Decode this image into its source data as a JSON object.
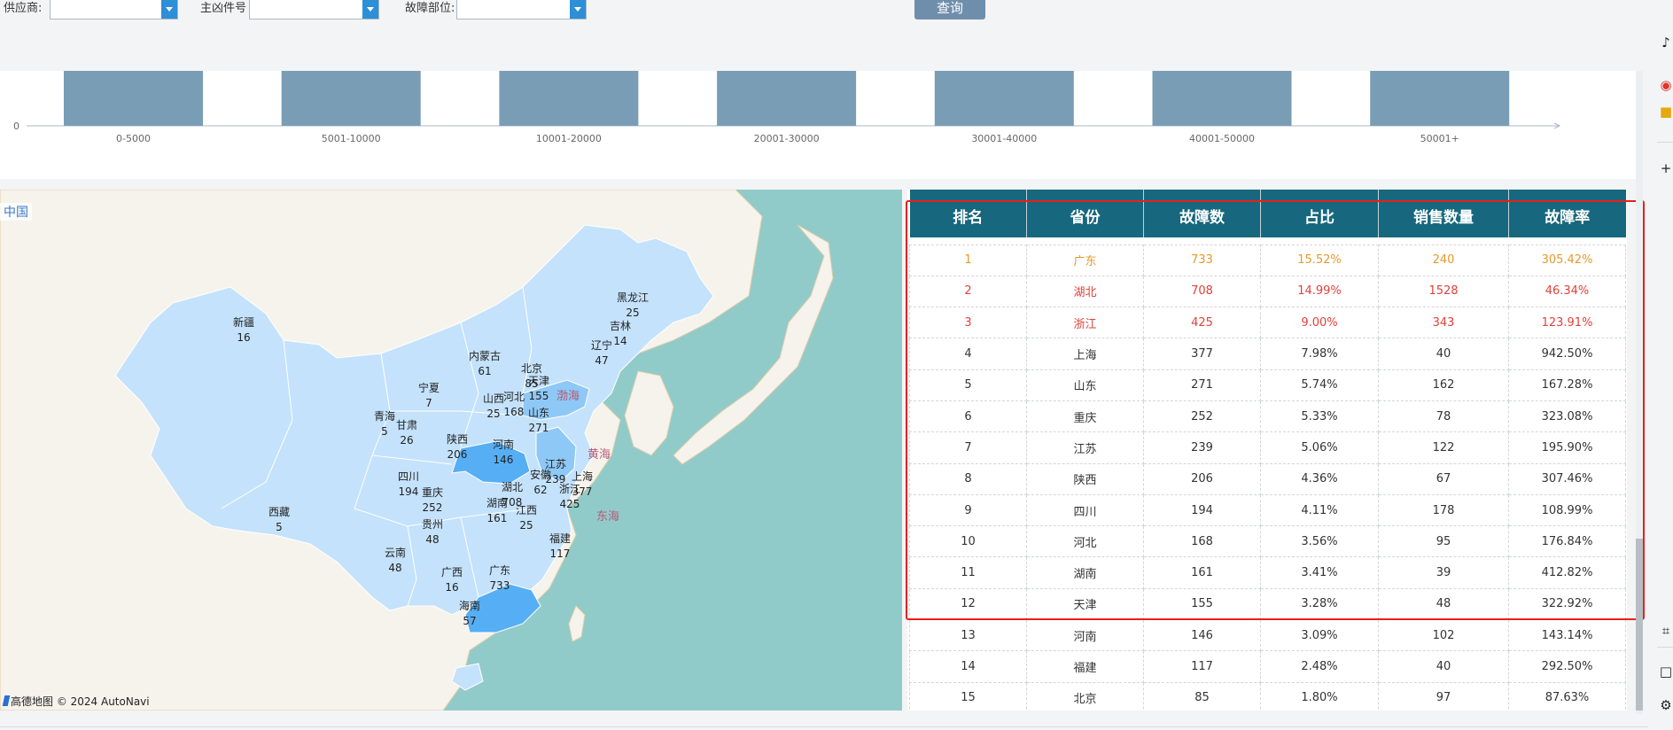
{
  "filters": {
    "supplier_label": "供应商:",
    "supplier_value": "",
    "part_label": "主凶件号",
    "part_value": "",
    "position_label": "故障部位:",
    "position_value": "",
    "query_label": "查询"
  },
  "chart_data": {
    "type": "bar",
    "categories": [
      "0-5000",
      "5001-10000",
      "10001-20000",
      "20001-30000",
      "30001-40000",
      "40001-50000",
      "50001+"
    ],
    "y_tick_visible": "0",
    "color": "#7a9db6",
    "grid": false
  },
  "map": {
    "country_label": "中国",
    "attribution": "高德地图 © 2024 AutoNavi",
    "land_color": "#f6f3ed",
    "sea_color": "#91cbc9",
    "highlight_colors": [
      "#c4e2fb",
      "#8ec8f6",
      "#56aef5"
    ],
    "sea_labels": [
      {
        "name": "渤海"
      },
      {
        "name": "黄海"
      },
      {
        "name": "东海"
      }
    ],
    "provinces": [
      {
        "name": "黑龙江",
        "value": "25"
      },
      {
        "name": "吉林",
        "value": "14"
      },
      {
        "name": "辽宁",
        "value": "47"
      },
      {
        "name": "新疆",
        "value": "16"
      },
      {
        "name": "内蒙古",
        "value": "61"
      },
      {
        "name": "北京",
        "value": "85"
      },
      {
        "name": "天津",
        "value": "155"
      },
      {
        "name": "河北",
        "value": "168"
      },
      {
        "name": "山西",
        "value": "25"
      },
      {
        "name": "宁夏",
        "value": "7"
      },
      {
        "name": "山东",
        "value": "271"
      },
      {
        "name": "青海",
        "value": "5"
      },
      {
        "name": "甘肃",
        "value": "26"
      },
      {
        "name": "陕西",
        "value": "206"
      },
      {
        "name": "河南",
        "value": "146"
      },
      {
        "name": "江苏",
        "value": "239"
      },
      {
        "name": "安徽",
        "value": "62"
      },
      {
        "name": "上海",
        "value": "377"
      },
      {
        "name": "四川",
        "value": "194"
      },
      {
        "name": "湖北",
        "value": "708"
      },
      {
        "name": "浙江",
        "value": "425"
      },
      {
        "name": "重庆",
        "value": "252"
      },
      {
        "name": "西藏",
        "value": "5"
      },
      {
        "name": "湖南",
        "value": "161"
      },
      {
        "name": "江西",
        "value": "25"
      },
      {
        "name": "贵州",
        "value": "48"
      },
      {
        "name": "福建",
        "value": "117"
      },
      {
        "name": "云南",
        "value": "48"
      },
      {
        "name": "广西",
        "value": "16"
      },
      {
        "name": "广东",
        "value": "733"
      },
      {
        "name": "海南",
        "value": "57"
      }
    ]
  },
  "table": {
    "headers": [
      "排名",
      "省份",
      "故障数",
      "占比",
      "销售数量",
      "故障率"
    ],
    "rows": [
      [
        "1",
        "广东",
        "733",
        "15.52%",
        "240",
        "305.42%"
      ],
      [
        "2",
        "湖北",
        "708",
        "14.99%",
        "1528",
        "46.34%"
      ],
      [
        "3",
        "浙江",
        "425",
        "9.00%",
        "343",
        "123.91%"
      ],
      [
        "4",
        "上海",
        "377",
        "7.98%",
        "40",
        "942.50%"
      ],
      [
        "5",
        "山东",
        "271",
        "5.74%",
        "162",
        "167.28%"
      ],
      [
        "6",
        "重庆",
        "252",
        "5.33%",
        "78",
        "323.08%"
      ],
      [
        "7",
        "江苏",
        "239",
        "5.06%",
        "122",
        "195.90%"
      ],
      [
        "8",
        "陕西",
        "206",
        "4.36%",
        "67",
        "307.46%"
      ],
      [
        "9",
        "四川",
        "194",
        "4.11%",
        "178",
        "108.99%"
      ],
      [
        "10",
        "河北",
        "168",
        "3.56%",
        "95",
        "176.84%"
      ],
      [
        "11",
        "湖南",
        "161",
        "3.41%",
        "39",
        "412.82%"
      ],
      [
        "12",
        "天津",
        "155",
        "3.28%",
        "48",
        "322.92%"
      ],
      [
        "13",
        "河南",
        "146",
        "3.09%",
        "102",
        "143.14%"
      ],
      [
        "14",
        "福建",
        "117",
        "2.48%",
        "40",
        "292.50%"
      ],
      [
        "15",
        "北京",
        "85",
        "1.80%",
        "97",
        "87.63%"
      ]
    ],
    "top_colors": {
      "1": "#e69a2a",
      "2": "#e0413a",
      "3": "#e0413a"
    },
    "highlight_color": "#e6201a"
  },
  "sidebar": {
    "icons": [
      "tiktok-icon",
      "weibo-icon",
      "app-icon",
      "add-icon",
      "crop-icon",
      "window-icon",
      "settings-icon"
    ]
  }
}
